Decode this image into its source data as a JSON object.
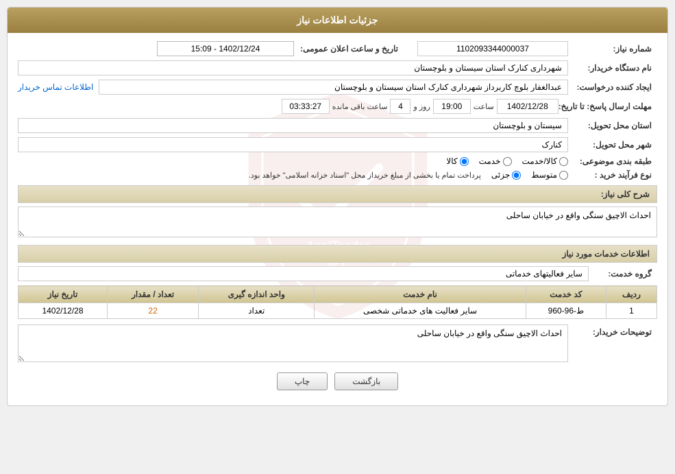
{
  "header": {
    "title": "جزئیات اطلاعات نیاز"
  },
  "fields": {
    "order_number_label": "شماره نیاز:",
    "order_number_value": "1102093344000037",
    "date_announce_label": "تاریخ و ساعت اعلان عمومی:",
    "date_announce_value": "1402/12/24 - 15:09",
    "buyer_org_label": "نام دستگاه خریدار:",
    "buyer_org_value": "شهرداری کنارک استان سیستان و بلوچستان",
    "creator_label": "ایجاد کننده درخواست:",
    "creator_value": "عبدالغفار بلوچ کاربرداز شهرداری کنارک استان سیستان و بلوچستان",
    "contact_link": "اطلاعات تماس خریدار",
    "deadline_label": "مهلت ارسال پاسخ: تا تاریخ:",
    "deadline_date": "1402/12/28",
    "deadline_time_label": "ساعت",
    "deadline_time": "19:00",
    "deadline_days_label": "روز و",
    "deadline_days": "4",
    "deadline_remaining_label": "ساعت باقی مانده",
    "deadline_remaining": "03:33:27",
    "province_label": "استان محل تحویل:",
    "province_value": "سیستان و بلوچستان",
    "city_label": "شهر محل تحویل:",
    "city_value": "کنارک",
    "category_label": "طبقه بندی موضوعی:",
    "radio_kala": "کالا",
    "radio_khedmat": "خدمت",
    "radio_kala_khedmat": "کالا/خدمت",
    "purchase_label": "نوع فرآیند خرید :",
    "radio_jozi": "جزئی",
    "radio_mottavasset": "متوسط",
    "purchase_note": "پرداخت تمام یا بخشی از مبلغ خریداز محل \"اسناد خزانه اسلامی\" خواهد بود.",
    "description_section": "شرح کلی نیاز:",
    "description_value": "احداث الاچیق سنگی واقع در خیابان ساحلی",
    "services_section": "اطلاعات خدمات مورد نیاز",
    "service_group_label": "گروه خدمت:",
    "service_group_value": "سایر فعالیتهای خدماتی",
    "table": {
      "col_row": "ردیف",
      "col_code": "کد خدمت",
      "col_name": "نام خدمت",
      "col_unit": "واحد اندازه گیری",
      "col_qty": "تعداد / مقدار",
      "col_date": "تاریخ نیاز",
      "rows": [
        {
          "row": "1",
          "code": "ط-96-960",
          "name": "سایر فعالیت های خدماتی شخصی",
          "unit": "تعداد",
          "qty": "22",
          "date": "1402/12/28"
        }
      ]
    },
    "buyer_notes_label": "توضیحات خریدار:",
    "buyer_notes_value": "احداث الاچیق سنگی واقع در خیابان ساحلی"
  },
  "buttons": {
    "print_label": "چاپ",
    "back_label": "بازگشت"
  }
}
